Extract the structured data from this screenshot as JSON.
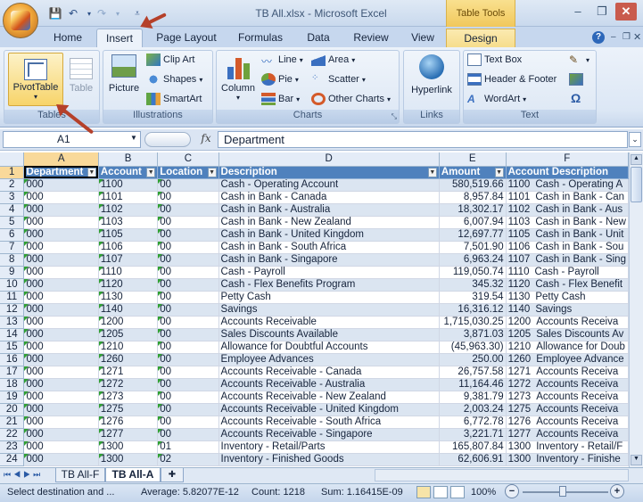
{
  "window": {
    "title": "TB All.xlsx - Microsoft Excel",
    "context_tab": "Table Tools"
  },
  "ribbon": {
    "tabs": [
      {
        "label": "Home"
      },
      {
        "label": "Insert"
      },
      {
        "label": "Page Layout"
      },
      {
        "label": "Formulas"
      },
      {
        "label": "Data"
      },
      {
        "label": "Review"
      },
      {
        "label": "View"
      },
      {
        "label": "Design"
      }
    ],
    "tables": {
      "pivot": "PivotTable",
      "table": "Table",
      "label": "Tables"
    },
    "illustrations": {
      "picture": "Picture",
      "clipart": "Clip Art",
      "shapes": "Shapes",
      "smartart": "SmartArt",
      "label": "Illustrations"
    },
    "charts": {
      "column": "Column",
      "line": "Line",
      "pie": "Pie",
      "bar": "Bar",
      "area": "Area",
      "scatter": "Scatter",
      "other": "Other Charts",
      "label": "Charts"
    },
    "links": {
      "hyperlink": "Hyperlink",
      "label": "Links"
    },
    "text": {
      "textbox": "Text Box",
      "headerfooter": "Header & Footer",
      "wordart": "WordArt",
      "label": "Text"
    }
  },
  "formula": {
    "cell": "A1",
    "fx": "fx",
    "value": "Department"
  },
  "columns": [
    "A",
    "B",
    "C",
    "D",
    "E",
    "F"
  ],
  "headers": [
    "Department",
    "Account",
    "Location",
    "Description",
    "Amount",
    "Account Description"
  ],
  "rows": [
    [
      "2",
      "000",
      "1100",
      "00",
      "Cash - Operating Account",
      "580,519.66",
      "1100",
      "Cash - Operating A"
    ],
    [
      "3",
      "000",
      "1101",
      "00",
      "Cash in Bank - Canada",
      "8,957.84",
      "1101",
      "Cash in Bank - Can"
    ],
    [
      "4",
      "000",
      "1102",
      "00",
      "Cash in Bank - Australia",
      "18,302.17",
      "1102",
      "Cash in Bank - Aus"
    ],
    [
      "5",
      "000",
      "1103",
      "00",
      "Cash in Bank - New Zealand",
      "6,007.94",
      "1103",
      "Cash in Bank - New"
    ],
    [
      "6",
      "000",
      "1105",
      "00",
      "Cash in Bank - United Kingdom",
      "12,697.77",
      "1105",
      "Cash in Bank - Unit"
    ],
    [
      "7",
      "000",
      "1106",
      "00",
      "Cash in Bank - South Africa",
      "7,501.90",
      "1106",
      "Cash in Bank - Sou"
    ],
    [
      "8",
      "000",
      "1107",
      "00",
      "Cash in Bank - Singapore",
      "6,963.24",
      "1107",
      "Cash in Bank - Sing"
    ],
    [
      "9",
      "000",
      "1110",
      "00",
      "Cash - Payroll",
      "119,050.74",
      "1110",
      "Cash - Payroll"
    ],
    [
      "10",
      "000",
      "1120",
      "00",
      "Cash - Flex Benefits Program",
      "345.32",
      "1120",
      "Cash - Flex Benefit"
    ],
    [
      "11",
      "000",
      "1130",
      "00",
      "Petty Cash",
      "319.54",
      "1130",
      "Petty Cash"
    ],
    [
      "12",
      "000",
      "1140",
      "00",
      "Savings",
      "16,316.12",
      "1140",
      "Savings"
    ],
    [
      "13",
      "000",
      "1200",
      "00",
      "Accounts Receivable",
      "1,715,030.25",
      "1200",
      "Accounts Receiva"
    ],
    [
      "14",
      "000",
      "1205",
      "00",
      "Sales Discounts Available",
      "3,871.03",
      "1205",
      "Sales Discounts Av"
    ],
    [
      "15",
      "000",
      "1210",
      "00",
      "Allowance for Doubtful Accounts",
      "(45,963.30)",
      "1210",
      "Allowance for Doub"
    ],
    [
      "16",
      "000",
      "1260",
      "00",
      "Employee Advances",
      "250.00",
      "1260",
      "Employee Advance"
    ],
    [
      "17",
      "000",
      "1271",
      "00",
      "Accounts Receivable - Canada",
      "26,757.58",
      "1271",
      "Accounts Receiva"
    ],
    [
      "18",
      "000",
      "1272",
      "00",
      "Accounts Receivable - Australia",
      "11,164.46",
      "1272",
      "Accounts Receiva"
    ],
    [
      "19",
      "000",
      "1273",
      "00",
      "Accounts Receivable - New Zealand",
      "9,381.79",
      "1273",
      "Accounts Receiva"
    ],
    [
      "20",
      "000",
      "1275",
      "00",
      "Accounts Receivable - United Kingdom",
      "2,003.24",
      "1275",
      "Accounts Receiva"
    ],
    [
      "21",
      "000",
      "1276",
      "00",
      "Accounts Receivable - South Africa",
      "6,772.78",
      "1276",
      "Accounts Receiva"
    ],
    [
      "22",
      "000",
      "1277",
      "00",
      "Accounts Receivable - Singapore",
      "3,221.71",
      "1277",
      "Accounts Receiva"
    ],
    [
      "23",
      "000",
      "1300",
      "01",
      "Inventory - Retail/Parts",
      "165,807.84",
      "1300",
      "Inventory - Retail/F"
    ],
    [
      "24",
      "000",
      "1300",
      "02",
      "Inventory - Finished Goods",
      "62,606.91",
      "1300",
      "Inventory - Finishe"
    ]
  ],
  "sheets": [
    {
      "name": "TB All-F"
    },
    {
      "name": "TB All-A"
    }
  ],
  "status": {
    "mode": "Select destination and ...",
    "average": "Average: 5.82077E-12",
    "count": "Count: 1218",
    "sum": "Sum: 1.16415E-09",
    "zoom": "100%"
  }
}
